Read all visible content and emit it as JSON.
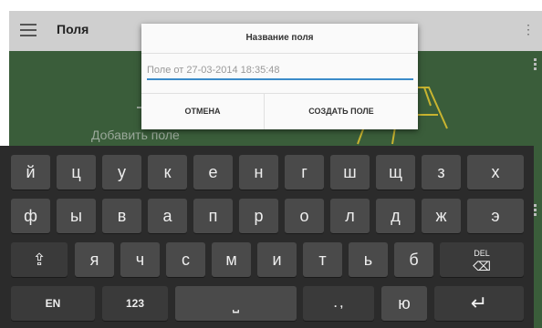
{
  "appbar": {
    "title": "Поля",
    "overflow": "⋮"
  },
  "map": {
    "add_field_label": "Добавить поле"
  },
  "dialog": {
    "title": "Название поля",
    "input_placeholder": "Поле от 27-03-2014 18:35:48",
    "cancel_label": "ОТМЕНА",
    "create_label": "СОЗДАТЬ ПОЛЕ"
  },
  "keyboard": {
    "row1": [
      "й",
      "ц",
      "у",
      "к",
      "е",
      "н",
      "г",
      "ш",
      "щ",
      "з",
      "х"
    ],
    "row2": [
      "ф",
      "ы",
      "в",
      "а",
      "п",
      "р",
      "о",
      "л",
      "д",
      "ж",
      "э"
    ],
    "row3": [
      "я",
      "ч",
      "с",
      "м",
      "и",
      "т",
      "ь",
      "б"
    ],
    "shift": "⇪",
    "del": "DEL",
    "del_symbol": "⌫",
    "lang": "EN",
    "numbers": "123",
    "space": "⎵",
    "punct": ". ,",
    "yu": "ю",
    "enter": "↵"
  }
}
